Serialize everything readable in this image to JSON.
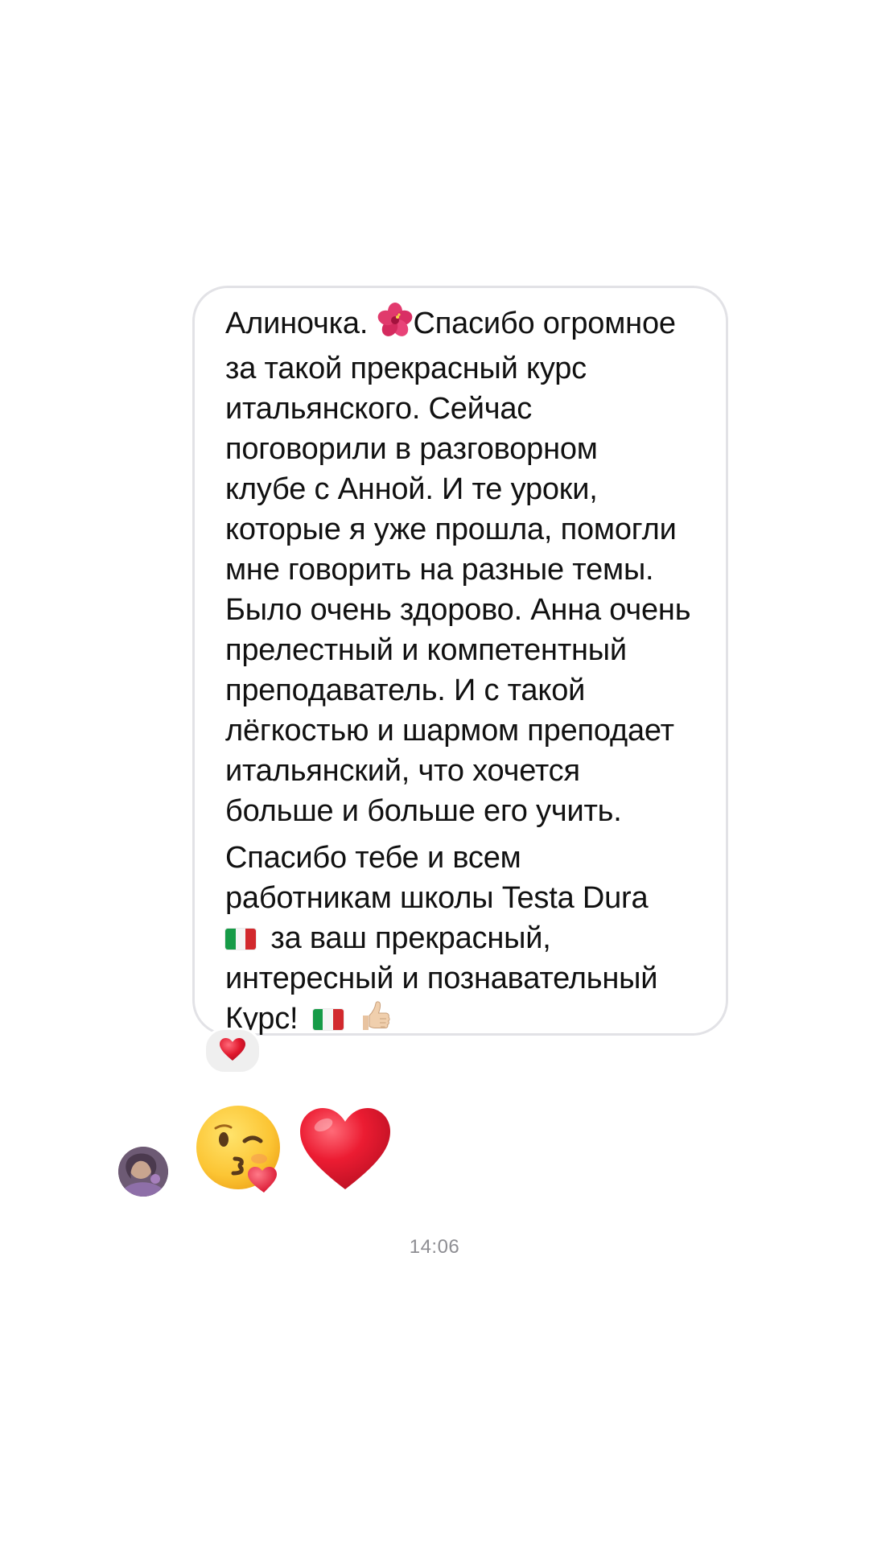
{
  "message": {
    "lines_para1": [
      "Алиночка.",
      "за такой прекрасный курс",
      "итальянского. Сейчас",
      "поговорили в разговорном",
      "клубе с Анной. И те уроки,",
      "которые я уже прошла, помогли",
      "мне говорить на разные темы.",
      "Было очень здорово. Анна очень",
      "прелестный и компетентный",
      "преподаватель. И с такой",
      "лёгкостью и шармом преподает",
      "итальянский, что хочется",
      "больше и больше его учить."
    ],
    "line1_after_emoji": "Спасибо огромное",
    "lines_para2": [
      "Спасибо тебе и всем",
      "работникам школы Testa Dura"
    ],
    "flag_line_text": "за ваш прекрасный,",
    "lines_para2_end": [
      "интересный и познавательный"
    ],
    "last_line_text": "Курс!"
  },
  "reaction": {
    "icon": "heart-icon"
  },
  "reply": {
    "emojis": [
      "kissing-face-with-heart-icon",
      "red-heart-icon"
    ]
  },
  "timestamp": "14:06",
  "colors": {
    "bubble_border": "#e2e2e6",
    "reaction_bg": "#efefef",
    "timestamp": "#8e8e93",
    "heart": "#e0182d"
  }
}
